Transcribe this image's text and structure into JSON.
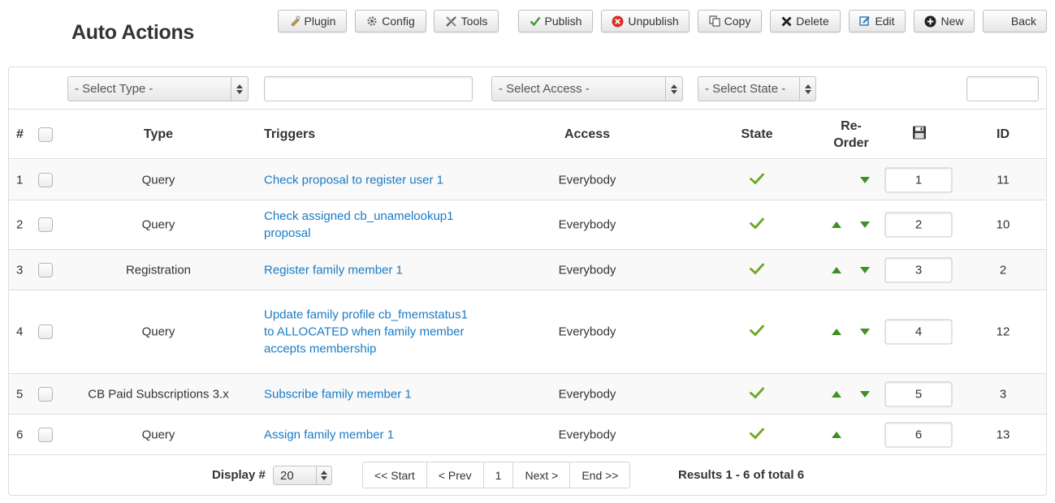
{
  "page": {
    "title": "Auto Actions"
  },
  "toolbar": {
    "plugin": "Plugin",
    "config": "Config",
    "tools": "Tools",
    "publish": "Publish",
    "unpublish": "Unpublish",
    "copy": "Copy",
    "delete": "Delete",
    "edit": "Edit",
    "new": "New",
    "back": "Back"
  },
  "filters": {
    "type": "- Select Type -",
    "search": "",
    "access": "- Select Access -",
    "state": "- Select State -",
    "id": ""
  },
  "table": {
    "headers": {
      "num": "#",
      "type": "Type",
      "triggers": "Triggers",
      "access": "Access",
      "state": "State",
      "reorder_1": "Re-",
      "reorder_2": "Order",
      "save_icon": "save-icon",
      "id": "ID"
    },
    "rows": [
      {
        "num": "1",
        "type": "Query",
        "trigger": "Check proposal to register user 1",
        "access": "Everybody",
        "state": "published",
        "up": false,
        "down": true,
        "order": "1",
        "id": "11"
      },
      {
        "num": "2",
        "type": "Query",
        "trigger": "Check assigned cb_unamelookup1 proposal",
        "access": "Everybody",
        "state": "published",
        "up": true,
        "down": true,
        "order": "2",
        "id": "10"
      },
      {
        "num": "3",
        "type": "Registration",
        "trigger": "Register family member 1",
        "access": "Everybody",
        "state": "published",
        "up": true,
        "down": true,
        "order": "3",
        "id": "2"
      },
      {
        "num": "4",
        "type": "Query",
        "trigger": "Update family profile cb_fmemstatus1 to ALLOCATED when family member accepts membership",
        "access": "Everybody",
        "state": "published",
        "up": true,
        "down": true,
        "order": "4",
        "id": "12"
      },
      {
        "num": "5",
        "type": "CB Paid Subscriptions 3.x",
        "trigger": "Subscribe family member 1",
        "access": "Everybody",
        "state": "published",
        "up": true,
        "down": true,
        "order": "5",
        "id": "3"
      },
      {
        "num": "6",
        "type": "Query",
        "trigger": "Assign family member 1",
        "access": "Everybody",
        "state": "published",
        "up": true,
        "down": false,
        "order": "6",
        "id": "13"
      }
    ]
  },
  "footer": {
    "display_label": "Display #",
    "display_value": "20",
    "pager": [
      "<< Start",
      "< Prev",
      "1",
      "Next >",
      "End >>"
    ],
    "results": "Results 1 - 6 of total 6"
  },
  "colors": {
    "link": "#1a7bc4",
    "check": "#6aa826",
    "arrow": "#3f8f25",
    "publish_icon": "#3d9a2f",
    "unpublish_icon": "#d9302c"
  }
}
